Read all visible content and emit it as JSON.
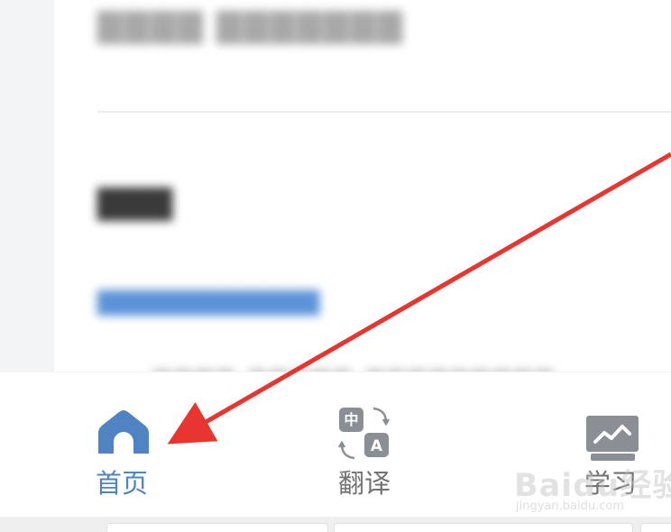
{
  "bottom_nav": {
    "items": [
      {
        "label": "首页",
        "icon": "home-icon",
        "active": true
      },
      {
        "label": "翻译",
        "icon": "translate-icon",
        "active": false
      },
      {
        "label": "学习",
        "icon": "learning-icon",
        "active": false
      }
    ]
  },
  "translate_icon_chars": {
    "source": "中",
    "target": "A"
  },
  "watermark": {
    "brand": "Baidu经验",
    "url": "jingyan.baidu.com"
  },
  "colors": {
    "active": "#4f83c1",
    "inactive": "#727272",
    "arrow": "#e8352f",
    "link": "#5b93d8"
  }
}
